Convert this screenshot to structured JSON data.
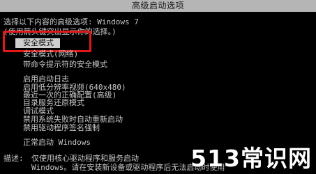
{
  "window": {
    "title": "高级启动选项"
  },
  "prompt": {
    "line1": "选择以下内容的高级选项: Windows 7",
    "line2": "(使用箭头键突出显示你的选择。)"
  },
  "menu": {
    "selected": "安全模式",
    "group1": [
      "安全模式(网络)",
      "带命令提示符的安全模式"
    ],
    "group2": [
      "启用启动日志",
      "启用低分辨率视频(640x480)",
      "最近一次的正确配置(高级)",
      "目录服务还原模式",
      "调试模式",
      "禁用系统失败时自动重新启动",
      "禁用驱动程序签名强制"
    ],
    "normal": "正常启动 Windows"
  },
  "description": {
    "label": "描述:",
    "line1": "仅使用核心驱动程序和服务启动",
    "line2": "Windows。请在安装新设备或驱动程序后无法启动时使用"
  },
  "watermark": "513常识网"
}
